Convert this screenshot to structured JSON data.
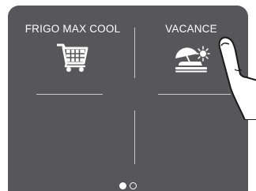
{
  "tiles": [
    {
      "label": "FRIGO MAX COOL",
      "icon": "shopping-cart-icon"
    },
    {
      "label": "VACANCE",
      "icon": "vacation-beach-icon"
    }
  ],
  "pagination": {
    "total": 2,
    "active": 1
  },
  "colors": {
    "screen_background": "#575759",
    "text": "#ffffff",
    "divider": "#c9c9c9"
  }
}
